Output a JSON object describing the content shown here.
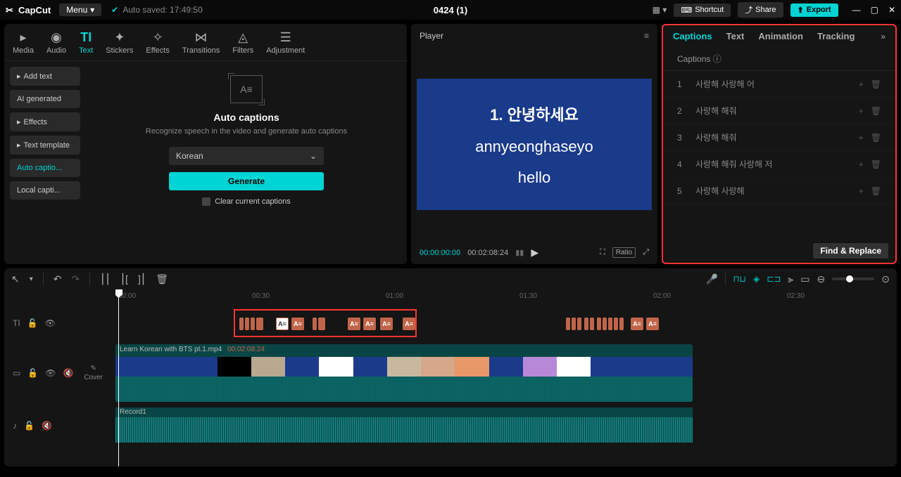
{
  "titlebar": {
    "app": "CapCut",
    "menu": "Menu",
    "autosave": "Auto saved: 17:49:50",
    "doc": "0424 (1)",
    "shortcut": "Shortcut",
    "share": "Share",
    "export": "Export"
  },
  "topTabs": {
    "media": "Media",
    "audio": "Audio",
    "text": "Text",
    "stickers": "Stickers",
    "effects": "Effects",
    "transitions": "Transitions",
    "filters": "Filters",
    "adjustment": "Adjustment"
  },
  "leftNav": {
    "addText": "Add text",
    "aiGenerated": "AI generated",
    "effects": "Effects",
    "textTemplate": "Text template",
    "autoCaptions": "Auto captio...",
    "localCaptions": "Local capti..."
  },
  "autoCaptions": {
    "title": "Auto captions",
    "desc": "Recognize speech in the video and generate auto captions",
    "language": "Korean",
    "generate": "Generate",
    "clear": "Clear current captions"
  },
  "player": {
    "label": "Player",
    "line1": "1. 안녕하세요",
    "line2": "annyeonghaseyo",
    "line3": "hello",
    "curTime": "00:00:00:00",
    "durTime": "00:02:08:24",
    "ratio": "Ratio"
  },
  "captionsPanel": {
    "tabs": {
      "captions": "Captions",
      "text": "Text",
      "animation": "Animation",
      "tracking": "Tracking"
    },
    "section": "Captions",
    "items": [
      {
        "n": "1",
        "t": "사랑해 사랑해 어"
      },
      {
        "n": "2",
        "t": "사랑해 해줘"
      },
      {
        "n": "3",
        "t": "사랑해 해줘"
      },
      {
        "n": "4",
        "t": "사랑해 해줘 사랑해 저"
      },
      {
        "n": "5",
        "t": "사랑해 사랑해"
      }
    ],
    "findReplace": "Find & Replace"
  },
  "timeline": {
    "ruler": [
      "00:00",
      "00:30",
      "01:00",
      "01:30",
      "02:00",
      "02:30"
    ],
    "videoClip": {
      "name": "Learn Korean with BTS pt.1.mp4",
      "dur": "00:02:08:24"
    },
    "audioClip": {
      "name": "Record1"
    },
    "cover": "Cover",
    "thumbColors": [
      "#1a3a8a",
      "#1a3a8a",
      "#1a3a8a",
      "#000",
      "#b8a890",
      "#1a3a8a",
      "#fff",
      "#1a3a8a",
      "#c8b8a0",
      "#d4a888",
      "#e89868",
      "#1a3a8a",
      "#b888d8",
      "#fff",
      "#1a3a8a",
      "#1a3a8a",
      "#1a3a8a"
    ]
  }
}
